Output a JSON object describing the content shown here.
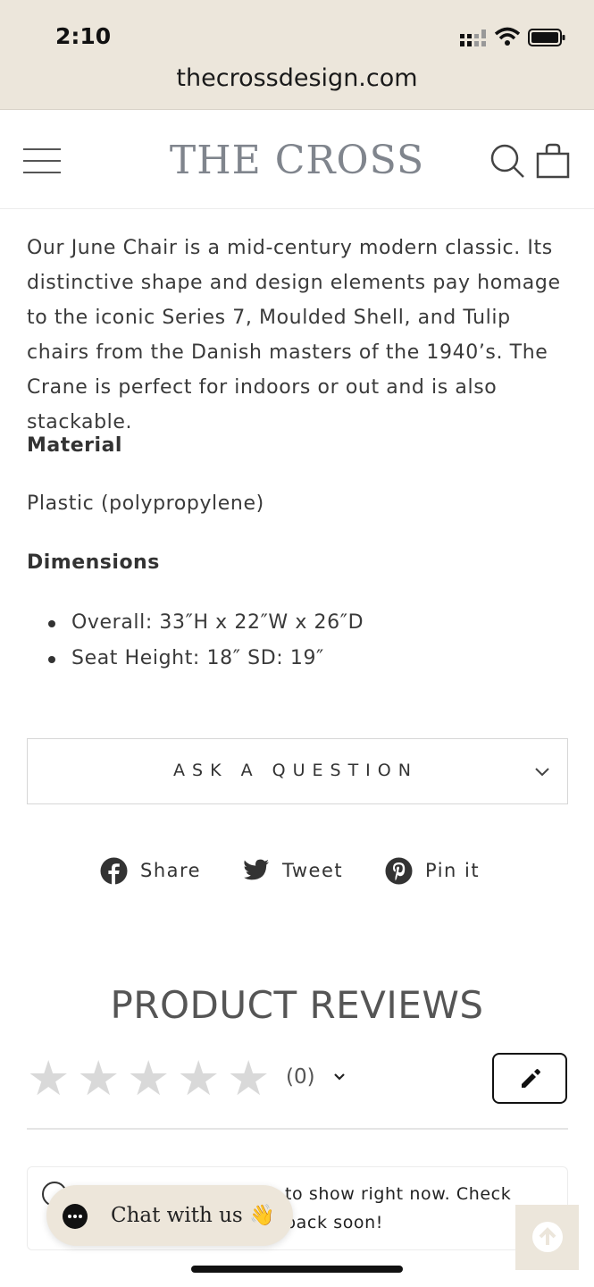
{
  "status_bar": {
    "time": "2:10"
  },
  "browser": {
    "url": "thecrossdesign.com"
  },
  "header": {
    "brand": "THE CROSS"
  },
  "product": {
    "description": "Our June Chair is a mid-century modern classic. Its distinctive shape and design elements pay homage to the iconic Series 7, Moulded Shell, and Tulip chairs from the Danish masters of the 1940’s. The Crane is perfect for indoors or out and is also stackable.",
    "material_heading": "Material",
    "material_value": "Plastic (polypropylene)",
    "dimensions_heading": "Dimensions",
    "dimensions": [
      "Overall: 33″H x 22″W x 26″D",
      "Seat Height: 18″ SD: 19″"
    ]
  },
  "ask_question": {
    "label": "ASK A QUESTION"
  },
  "share": {
    "facebook": "Share",
    "twitter": "Tweet",
    "pinterest": "Pin it"
  },
  "reviews": {
    "title": "PRODUCT REVIEWS",
    "rating": 0,
    "count": "(0)",
    "empty_text": "to show right now. Check back soon!"
  },
  "chat": {
    "label": "Chat with us",
    "emoji": "👋"
  },
  "colors": {
    "chrome": "#ece6db",
    "brand": "#80858d",
    "star_empty": "#d9d9d9"
  }
}
